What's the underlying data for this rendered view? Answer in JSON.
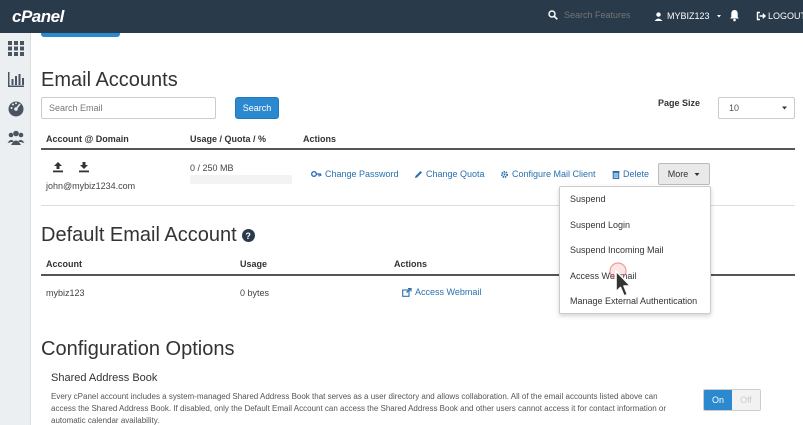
{
  "header": {
    "logo": "cPanel",
    "search_placeholder": "Search Features",
    "username": "MYBIZ123",
    "logout_label": "LOGOUT"
  },
  "sidebar": {
    "icons": [
      "grid-icon",
      "stats-icon",
      "dashboard-icon",
      "users-icon"
    ]
  },
  "email_accounts": {
    "title": "Email Accounts",
    "search_placeholder": "Search Email",
    "search_button": "Search",
    "page_size_label": "Page Size",
    "page_size_value": "10",
    "columns": {
      "account": "Account @ Domain",
      "usage": "Usage / Quota / %",
      "actions": "Actions"
    },
    "rows": [
      {
        "account": "john@mybiz1234.com",
        "usage": "0 / 250 MB",
        "actions": {
          "change_password": "Change Password",
          "change_quota": "Change Quota",
          "configure_mail_client": "Configure Mail Client",
          "delete": "Delete",
          "more": "More"
        }
      }
    ],
    "more_menu": [
      "Suspend",
      "Suspend Login",
      "Suspend Incoming Mail",
      "Access Webmail",
      "Manage External Authentication"
    ]
  },
  "default_account": {
    "title": "Default Email Account",
    "columns": {
      "account": "Account",
      "usage": "Usage",
      "actions": "Actions"
    },
    "row": {
      "account": "mybiz123",
      "usage": "0 bytes",
      "action": "Access Webmail"
    }
  },
  "config": {
    "title": "Configuration Options",
    "shared_address_book": {
      "title": "Shared Address Book",
      "description": "Every cPanel account includes a system-managed Shared Address Book that serves as a user directory and allows collaboration. All of the email accounts listed above can access the Shared Address Book. If disabled, only the Default Email Account can access the Shared Address Book and other users cannot access it for contact information or automatic calendar availability.",
      "toggle_on": "On",
      "toggle_off": "Off"
    }
  },
  "colors": {
    "topbar": "#293a4a",
    "accent": "#2c88cf",
    "link": "#2a6fb0"
  }
}
